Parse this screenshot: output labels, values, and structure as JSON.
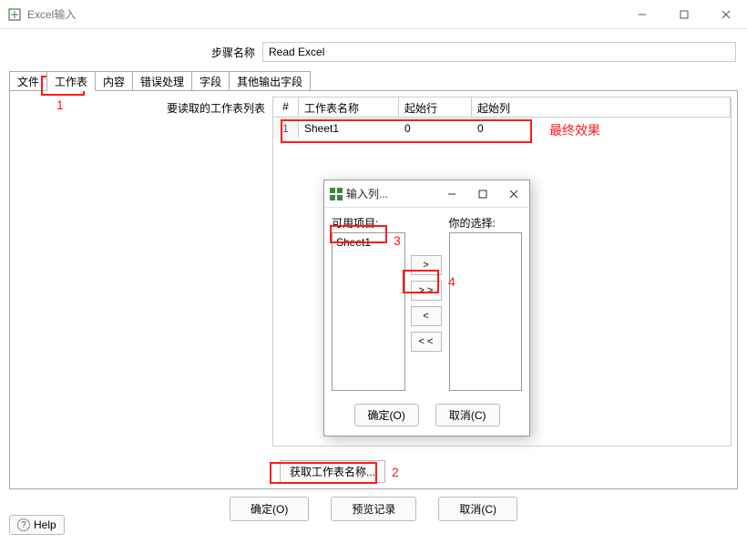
{
  "window": {
    "title": "Excel输入"
  },
  "step": {
    "label": "步骤名称",
    "value": "Read Excel"
  },
  "tabs": {
    "file": "文件",
    "worksheet": "工作表",
    "content": "内容",
    "error": "错误处理",
    "fields": "字段",
    "otherfields": "其他输出字段"
  },
  "table": {
    "label": "要读取的工作表列表",
    "head": {
      "num": "#",
      "name": "工作表名称",
      "startRow": "起始行",
      "startCol": "起始列"
    },
    "rows": [
      {
        "num": "1",
        "name": "Sheet1",
        "startRow": "0",
        "startCol": "0"
      }
    ]
  },
  "getSheetsBtn": "获取工作表名称...",
  "footer": {
    "ok": "确定(O)",
    "preview": "预览记录",
    "cancel": "取消(C)",
    "help": "Help"
  },
  "modal": {
    "title": "输入列...",
    "availableLabel": "可用项目:",
    "yourChoiceLabel": "你的选择:",
    "availableItems": [
      "Sheet1"
    ],
    "buttons": {
      "add": ">",
      "addAll": "> >",
      "remove": "<",
      "removeAll": "< <"
    },
    "ok": "确定(O)",
    "cancel": "取消(C)"
  },
  "annotations": {
    "n1": "1",
    "n2": "2",
    "n3": "3",
    "n4": "4",
    "final": "最终效果"
  }
}
